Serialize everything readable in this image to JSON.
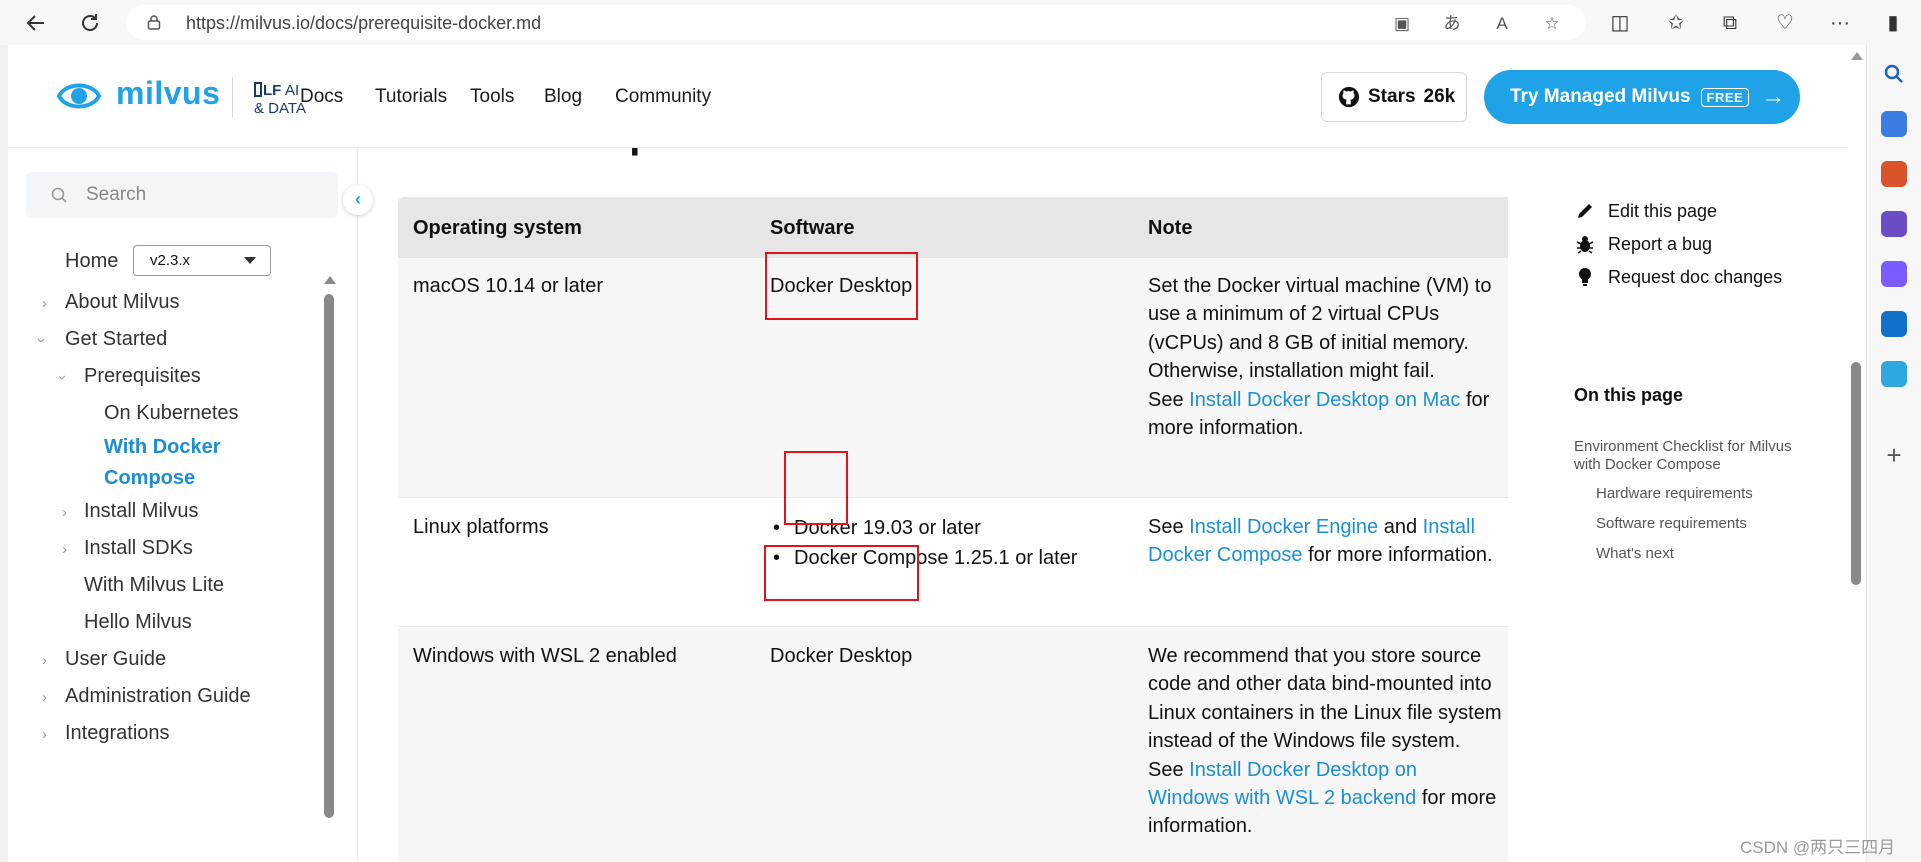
{
  "browser": {
    "url": "https://milvus.io/docs/prerequisite-docker.md"
  },
  "header": {
    "logo_text": "milvus",
    "lf_logo_text": "LF AI & DATA",
    "nav": [
      "Docs",
      "Tutorials",
      "Tools",
      "Blog",
      "Community"
    ],
    "stars_label": "Stars",
    "stars_count": "26k",
    "cta_label": "Try Managed Milvus",
    "cta_badge": "FREE"
  },
  "sidebar": {
    "search_placeholder": "Search",
    "home_label": "Home",
    "version": "v2.3.x",
    "items": [
      {
        "label": "About Milvus",
        "level": 0,
        "chevron": "right"
      },
      {
        "label": "Get Started",
        "level": 0,
        "chevron": "down"
      },
      {
        "label": "Prerequisites",
        "level": 1,
        "chevron": "down"
      },
      {
        "label": "On Kubernetes",
        "level": 2
      },
      {
        "label": "With Docker Compose",
        "level": 2,
        "active": true
      },
      {
        "label": "Install Milvus",
        "level": 1,
        "chevron": "right"
      },
      {
        "label": "Install SDKs",
        "level": 1,
        "chevron": "right"
      },
      {
        "label": "With Milvus Lite",
        "level": 1
      },
      {
        "label": "Hello Milvus",
        "level": 1
      },
      {
        "label": "User Guide",
        "level": 0,
        "chevron": "right"
      },
      {
        "label": "Administration Guide",
        "level": 0,
        "chevron": "right"
      },
      {
        "label": "Integrations",
        "level": 0,
        "chevron": "right"
      }
    ]
  },
  "main": {
    "section_heading": "Software requirements",
    "table": {
      "headers": [
        "Operating system",
        "Software",
        "Note"
      ],
      "rows": [
        {
          "os": "macOS 10.14 or later",
          "software": "Docker Desktop",
          "note_text": "Set the Docker virtual machine (VM) to use a minimum of 2 virtual CPUs (vCPUs) and 8 GB of initial memory. Otherwise, installation might fail.",
          "note_see": "See",
          "note_link": "Install Docker Desktop on Mac",
          "note_after": "for more information."
        },
        {
          "os": "Linux platforms",
          "software_list": [
            "Docker 19.03 or later",
            "Docker Compose 1.25.1 or later"
          ],
          "note_see": "See",
          "note_link1": "Install Docker Engine",
          "note_and": "and",
          "note_link2": "Install Docker Compose",
          "note_after": "for more information."
        },
        {
          "os": "Windows with WSL 2 enabled",
          "software": "Docker Desktop",
          "note_text": "We recommend that you store source code and other data bind-mounted into Linux containers in the Linux file system instead of the Windows file system.",
          "note_see": "See",
          "note_link": "Install Docker Desktop on Windows with WSL 2 backend",
          "note_after": "for more information."
        }
      ]
    }
  },
  "right_panel": {
    "edit": "Edit this page",
    "bug": "Report a bug",
    "request": "Request doc changes",
    "on_this_page": "On this page",
    "toc": [
      {
        "label": "Environment Checklist for Milvus with Docker Compose",
        "level": 0
      },
      {
        "label": "Hardware requirements",
        "level": 1
      },
      {
        "label": "Software requirements",
        "level": 1
      },
      {
        "label": "What's next",
        "level": 1
      }
    ]
  },
  "watermark": "CSDN @两只三四月",
  "colors": {
    "accent": "#1fa2e8",
    "link": "#1a8fd6",
    "highlight_box": "#e0141c",
    "table_header_bg": "#e6e6e6",
    "table_row_bg": "#f6f6f6"
  }
}
